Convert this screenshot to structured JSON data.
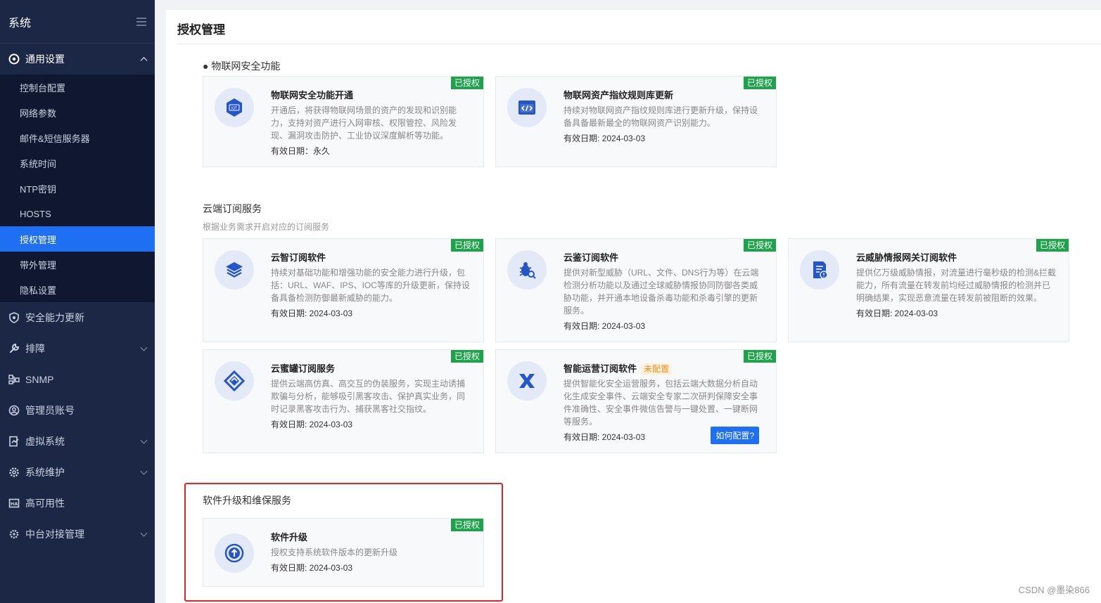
{
  "sidebar": {
    "title": "系统",
    "open_group": "通用设置",
    "sub_items": [
      "控制台配置",
      "网络参数",
      "邮件&短信服务器",
      "系统时间",
      "NTP密钥",
      "HOSTS",
      "授权管理",
      "带外管理",
      "隐私设置"
    ],
    "active_item": "授权管理",
    "groups": [
      {
        "label": "安全能力更新",
        "icon": "shield-icon",
        "has_chevron": false
      },
      {
        "label": "排障",
        "icon": "wrench-icon",
        "has_chevron": true
      },
      {
        "label": "SNMP",
        "icon": "network-icon",
        "has_chevron": false
      },
      {
        "label": "管理员账号",
        "icon": "user-circle-icon",
        "has_chevron": false
      },
      {
        "label": "虚拟系统",
        "icon": "virtual-system-icon",
        "has_chevron": true
      },
      {
        "label": "系统维护",
        "icon": "gear-icon",
        "has_chevron": true
      },
      {
        "label": "高可用性",
        "icon": "ha-icon",
        "has_chevron": false
      },
      {
        "label": "中台对接管理",
        "icon": "cog-cluster-icon",
        "has_chevron": true
      }
    ]
  },
  "page": {
    "title": "授权管理"
  },
  "sections": {
    "iot": {
      "title": "● 物联网安全功能"
    },
    "cloud": {
      "title": "云端订阅服务",
      "desc": "根据业务需求开启对应的订阅服务"
    },
    "upgrade": {
      "title": "软件升级和维保服务"
    }
  },
  "date_label": "有效日期: ",
  "cards": {
    "iot_security": {
      "name": "物联网安全功能开通",
      "desc": "开通后，将获得物联网场景的资产的发现和识别能力，支持对资产进行入网审核、权限管控、风险发现、漏洞攻击防护、工业协议深度解析等功能。",
      "date": "永久",
      "date_label": "有效日期：",
      "badge": "已授权",
      "icon": "iot-icon"
    },
    "iot_fingerprint": {
      "name": "物联网资产指纹规则库更新",
      "desc": "持续对物联网资产指纹规则库进行更新升级，保持设备具备最新最全的物联网资产识别能力。",
      "date": "2024-03-03",
      "badge": "已授权",
      "icon": "code-window-icon"
    },
    "cloud_smart": {
      "name": "云智订阅软件",
      "desc": "持续对基础功能和增强功能的安全能力进行升级，包括：URL、WAF、IPS、IOC等库的升级更新，保持设备具备检测防御最新威胁的能力。",
      "date": "2024-03-03",
      "badge": "已授权",
      "icon": "layers-icon"
    },
    "cloud_detect": {
      "name": "云鉴订阅软件",
      "desc": "提供对新型威胁（URL、文件、DNS行为等）在云端检测分析功能以及通过全球威胁情报协同防御各类威胁功能，并开通本地设备杀毒功能和杀毒引擎的更新服务。",
      "date": "2024-03-03",
      "badge": "已授权",
      "icon": "bug-search-icon"
    },
    "cloud_threat": {
      "name": "云威胁情报网关订阅软件",
      "desc": "提供亿万级威胁情报，对流量进行毫秒级的检测&拦截能力，所有流量在转发前均经过威胁情报的检测并已明确结果，实现恶意流量在转发前被阻断的效果。",
      "date": "2024-03-03",
      "badge": "已授权",
      "icon": "document-alert-icon"
    },
    "cloud_honeypot": {
      "name": "云蜜罐订阅服务",
      "desc": "提供云端高仿真、高交互的伪装服务，实现主动诱捕欺骗与分析，能够吸引黑客攻击、保护真实业务，同时记录黑客攻击行为、捕获黑客社交指纹。",
      "date": "2024-03-03",
      "badge": "已授权",
      "icon": "honeypot-icon"
    },
    "smart_ops": {
      "name": "智能运营订阅软件",
      "tag": "未配置",
      "desc": "提供智能化安全运营服务，包括云端大数据分析自动化生成安全事件、云端安全专家二次研判保障安全事件准确性、安全事件微信告警与一键处置、一键断网等服务。",
      "date": "2024-03-03",
      "badge": "已授权",
      "button": "如何配置?",
      "icon": "x-logo-icon"
    },
    "software_upgrade": {
      "name": "软件升级",
      "desc": "授权支持系统软件版本的更新升级",
      "date": "2024-03-03",
      "badge": "已授权",
      "icon": "upload-circle-icon"
    }
  },
  "watermark": "CSDN @墨染866",
  "colors": {
    "sidebar_bg": "#1b2744",
    "active": "#1e6ff1",
    "badge_green": "#1ea34a",
    "highlight_red": "#e02424",
    "warn_orange": "#fa8c16"
  }
}
